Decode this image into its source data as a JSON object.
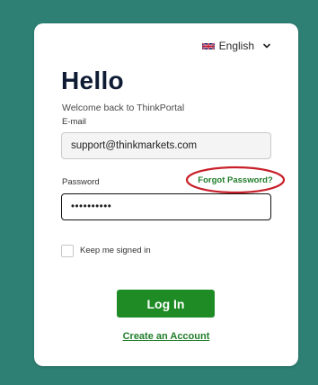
{
  "language": {
    "label": "English",
    "flag_icon": "uk-flag-icon",
    "chevron_icon": "chevron-down-icon"
  },
  "header": {
    "title": "Hello",
    "subtitle": "Welcome back to ThinkPortal"
  },
  "form": {
    "email_label": "E-mail",
    "email_value": "support@thinkmarkets.com",
    "password_label": "Password",
    "password_value": "••••••••••",
    "forgot_label": "Forgot Password?",
    "remember_label": "Keep me signed in",
    "remember_checked": false,
    "login_label": "Log In",
    "create_account_label": "Create an Account"
  },
  "colors": {
    "background": "#2e7f74",
    "accent_green": "#1e8b25",
    "link_green": "#1f7d2a",
    "highlight_red": "#c8202a"
  }
}
